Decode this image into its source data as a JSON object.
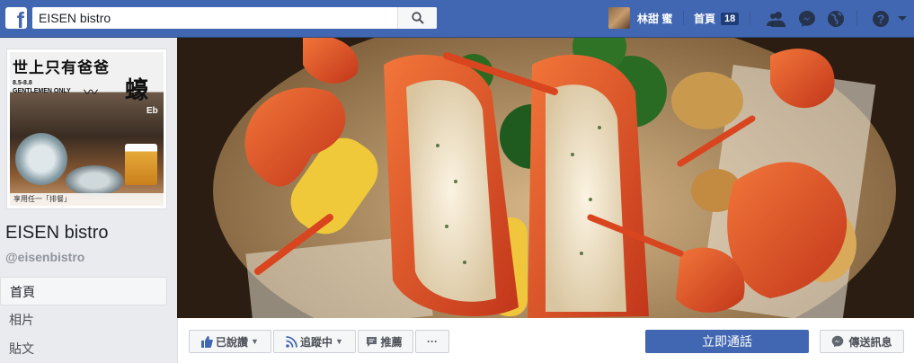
{
  "topbar": {
    "logo": "f",
    "search_value": "EISEN bistro",
    "user_name": "林甜 蜜",
    "home_label": "首頁",
    "home_badge": "18",
    "icons": [
      "search-icon",
      "friends-icon",
      "messenger-icon",
      "globe-icon",
      "help-icon",
      "caret-down-icon"
    ]
  },
  "profile_picture": {
    "headline": "世上只有爸爸",
    "dates": "8.5-8.8",
    "sub": "GENTLEMEN ONLY",
    "oyster_char": "蠔",
    "mark": "Eb",
    "footer": "享用任一「排餐」"
  },
  "page": {
    "name": "EISEN bistro",
    "handle": "@eisenbistro"
  },
  "nav": {
    "items": [
      "首頁",
      "相片",
      "貼文"
    ]
  },
  "actions": {
    "like": "已說讚",
    "follow": "追蹤中",
    "recommend": "推薦",
    "more": "···",
    "call": "立即通話",
    "message": "傳送訊息"
  },
  "colors": {
    "brand": "#4267b2",
    "bg": "#e9ebee"
  }
}
